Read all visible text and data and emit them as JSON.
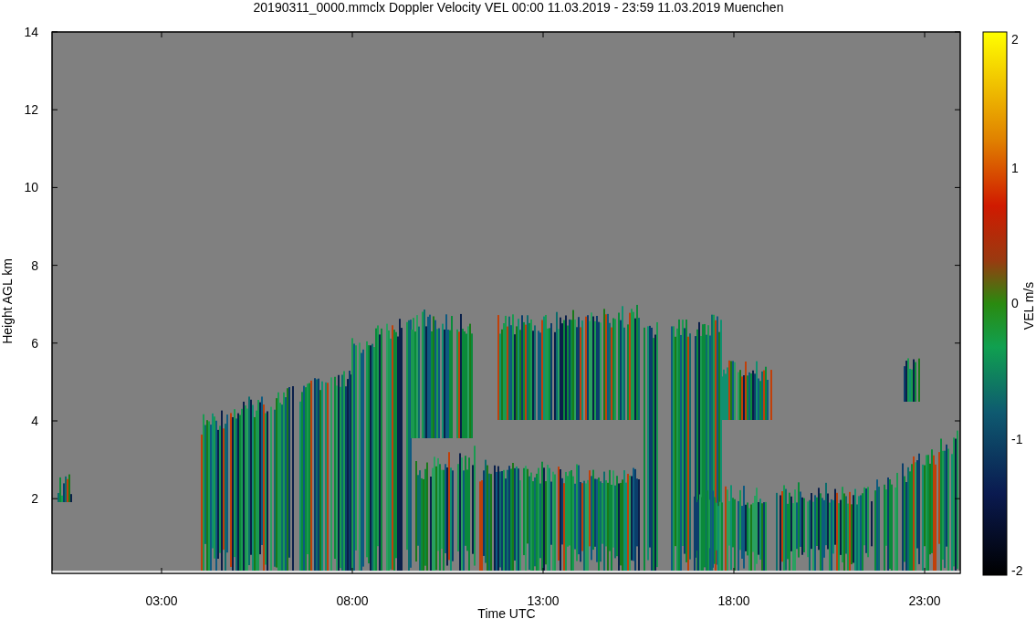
{
  "plot": {
    "title": "20190311_0000.mmclx Doppler Velocity VEL   00:00 11.03.2019 - 23:59 11.03.2019 Muenchen",
    "ylabel": "Height AGL km",
    "xlabel": "Time UTC",
    "yticks": [
      "14",
      "12",
      "10",
      "8",
      "6",
      "4",
      "2"
    ],
    "xticks": [
      "03:00",
      "08:00",
      "13:00",
      "18:00",
      "23:00"
    ]
  },
  "colorbar": {
    "label": "VEL m/s",
    "ticks": [
      "2",
      "1",
      "0",
      "-1",
      "-2"
    ]
  }
}
